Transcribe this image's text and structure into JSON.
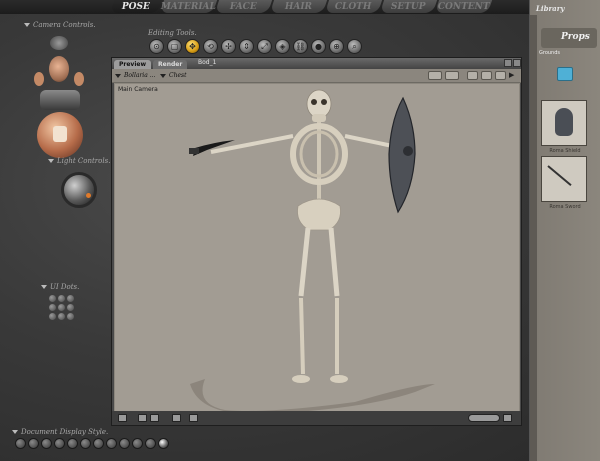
{
  "rooms": [
    {
      "label": "POSE",
      "active": true
    },
    {
      "label": "MATERIAL",
      "active": false
    },
    {
      "label": "FACE",
      "active": false
    },
    {
      "label": "HAIR",
      "active": false
    },
    {
      "label": "CLOTH",
      "active": false
    },
    {
      "label": "SETUP",
      "active": false
    },
    {
      "label": "CONTENT",
      "active": false
    }
  ],
  "left": {
    "camera_controls": "Camera Controls.",
    "editing_tools": "Editing Tools.",
    "light_controls": "Light Controls.",
    "ui_dots": "UI Dots.",
    "document_display_style": "Document Display Style."
  },
  "document": {
    "title": "Bod_1",
    "tabs": [
      {
        "label": "Preview",
        "active": true
      },
      {
        "label": "Render",
        "active": false
      }
    ],
    "figure_select": "Bollaria ...",
    "part_select": "Chest",
    "viewport_label": "Main Camera"
  },
  "library": {
    "title": "Library",
    "category": "Props",
    "subcategory": "Grounds",
    "items": [
      {
        "label": "Roma Shield"
      },
      {
        "label": "Roma Sword"
      }
    ]
  },
  "colors": {
    "viewport_bg": "#a29c93",
    "accent_tool": "#d49a14",
    "bone": "#dcd5c6"
  }
}
